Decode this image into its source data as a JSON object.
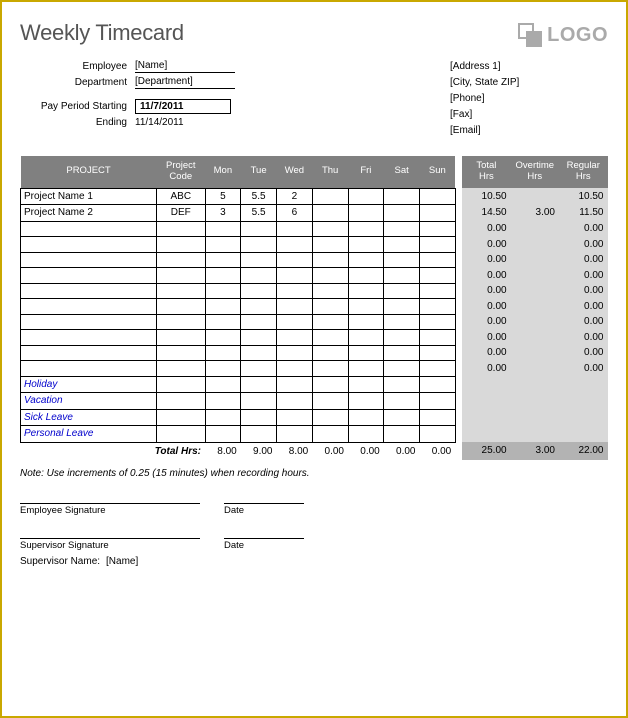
{
  "title": "Weekly Timecard",
  "logo_text": "LOGO",
  "labels": {
    "employee": "Employee",
    "department": "Department",
    "pay_start": "Pay Period Starting",
    "pay_end": "Ending",
    "total_hrs_row": "Total Hrs:",
    "emp_sig": "Employee Signature",
    "sup_sig": "Supervisor Signature",
    "sup_name": "Supervisor Name:",
    "date": "Date"
  },
  "employee": {
    "name": "[Name]",
    "department": "[Department]",
    "pay_start": "11/7/2011",
    "pay_end": "11/14/2011"
  },
  "company": {
    "address1": "[Address 1]",
    "city_state_zip": "[City, State  ZIP]",
    "phone": "[Phone]",
    "fax": "[Fax]",
    "email": "[Email]"
  },
  "columns": {
    "project": "PROJECT",
    "code": "Project\nCode",
    "days": [
      "Mon",
      "Tue",
      "Wed",
      "Thu",
      "Fri",
      "Sat",
      "Sun"
    ],
    "total": "Total\nHrs",
    "overtime": "Overtime\nHrs",
    "regular": "Regular\nHrs"
  },
  "rows": [
    {
      "project": "Project Name 1",
      "code": "ABC",
      "days": [
        "5",
        "5.5",
        "2",
        "",
        "",
        "",
        ""
      ],
      "total": "10.50",
      "ot": "",
      "reg": "10.50"
    },
    {
      "project": "Project Name 2",
      "code": "DEF",
      "days": [
        "3",
        "5.5",
        "6",
        "",
        "",
        "",
        ""
      ],
      "total": "14.50",
      "ot": "3.00",
      "reg": "11.50"
    },
    {
      "project": "",
      "code": "",
      "days": [
        "",
        "",
        "",
        "",
        "",
        "",
        ""
      ],
      "total": "0.00",
      "ot": "",
      "reg": "0.00"
    },
    {
      "project": "",
      "code": "",
      "days": [
        "",
        "",
        "",
        "",
        "",
        "",
        ""
      ],
      "total": "0.00",
      "ot": "",
      "reg": "0.00"
    },
    {
      "project": "",
      "code": "",
      "days": [
        "",
        "",
        "",
        "",
        "",
        "",
        ""
      ],
      "total": "0.00",
      "ot": "",
      "reg": "0.00"
    },
    {
      "project": "",
      "code": "",
      "days": [
        "",
        "",
        "",
        "",
        "",
        "",
        ""
      ],
      "total": "0.00",
      "ot": "",
      "reg": "0.00"
    },
    {
      "project": "",
      "code": "",
      "days": [
        "",
        "",
        "",
        "",
        "",
        "",
        ""
      ],
      "total": "0.00",
      "ot": "",
      "reg": "0.00"
    },
    {
      "project": "",
      "code": "",
      "days": [
        "",
        "",
        "",
        "",
        "",
        "",
        ""
      ],
      "total": "0.00",
      "ot": "",
      "reg": "0.00"
    },
    {
      "project": "",
      "code": "",
      "days": [
        "",
        "",
        "",
        "",
        "",
        "",
        ""
      ],
      "total": "0.00",
      "ot": "",
      "reg": "0.00"
    },
    {
      "project": "",
      "code": "",
      "days": [
        "",
        "",
        "",
        "",
        "",
        "",
        ""
      ],
      "total": "0.00",
      "ot": "",
      "reg": "0.00"
    },
    {
      "project": "",
      "code": "",
      "days": [
        "",
        "",
        "",
        "",
        "",
        "",
        ""
      ],
      "total": "0.00",
      "ot": "",
      "reg": "0.00"
    },
    {
      "project": "",
      "code": "",
      "days": [
        "",
        "",
        "",
        "",
        "",
        "",
        ""
      ],
      "total": "0.00",
      "ot": "",
      "reg": "0.00"
    }
  ],
  "category_rows": [
    "Holiday",
    "Vacation",
    "Sick Leave",
    "Personal Leave"
  ],
  "totals": {
    "days": [
      "8.00",
      "9.00",
      "8.00",
      "0.00",
      "0.00",
      "0.00",
      "0.00"
    ],
    "total": "25.00",
    "ot": "3.00",
    "reg": "22.00"
  },
  "note": "Note: Use increments of 0.25 (15 minutes) when recording hours.",
  "supervisor_name": "[Name]"
}
